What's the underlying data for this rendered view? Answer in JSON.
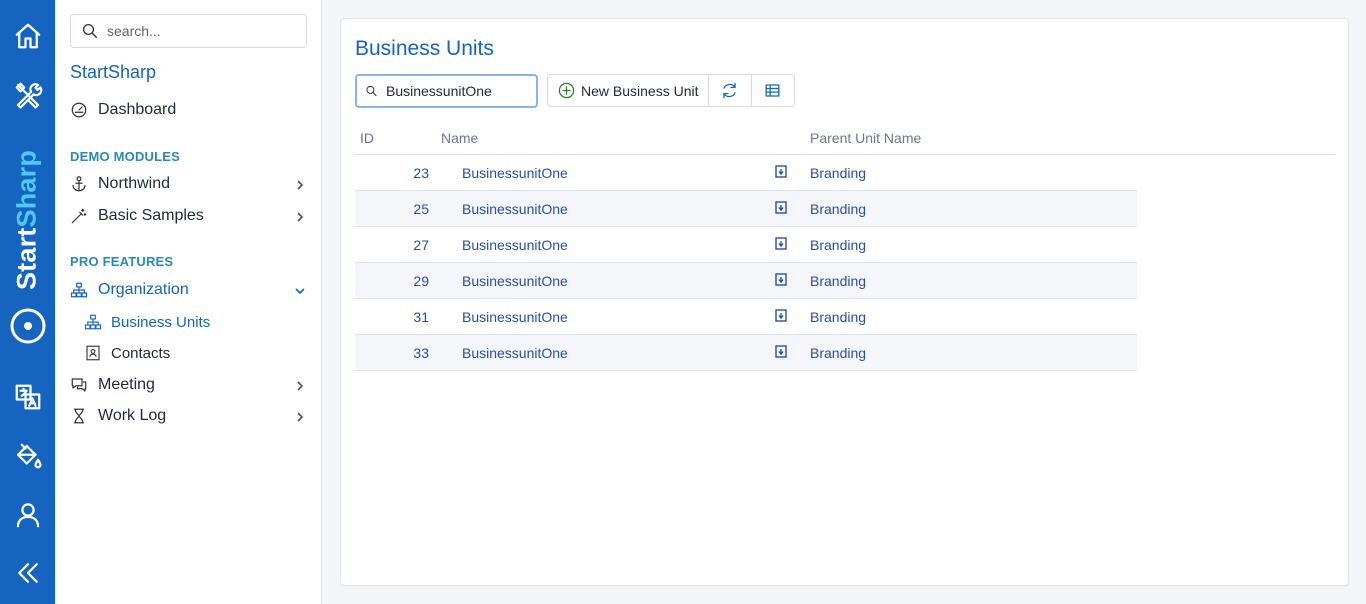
{
  "rail": {
    "brand_start": "Start",
    "brand_sharp": "Sharp"
  },
  "sidebar": {
    "search_placeholder": "search...",
    "app_title": "StartSharp",
    "dashboard": "Dashboard",
    "demo_modules_header": "DEMO MODULES",
    "northwind": "Northwind",
    "basic_samples": "Basic Samples",
    "pro_features_header": "PRO FEATURES",
    "organization": "Organization",
    "business_units": "Business Units",
    "contacts": "Contacts",
    "meeting": "Meeting",
    "work_log": "Work Log"
  },
  "main": {
    "title": "Business Units",
    "quick_search_value": "BusinessunitOne",
    "new_button": "New Business Unit",
    "columns": {
      "id": "ID",
      "name": "Name",
      "parent": "Parent Unit Name"
    },
    "rows": [
      {
        "id": "23",
        "name": "BusinessunitOne",
        "parent": "Branding"
      },
      {
        "id": "25",
        "name": "BusinessunitOne",
        "parent": "Branding"
      },
      {
        "id": "27",
        "name": "BusinessunitOne",
        "parent": "Branding"
      },
      {
        "id": "29",
        "name": "BusinessunitOne",
        "parent": "Branding"
      },
      {
        "id": "31",
        "name": "BusinessunitOne",
        "parent": "Branding"
      },
      {
        "id": "33",
        "name": "BusinessunitOne",
        "parent": "Branding"
      }
    ]
  },
  "colors": {
    "rail": "#1565c0",
    "accent": "#1565c0",
    "section_header": "#2a8ab8",
    "link": "#2a4fa8",
    "add_icon": "#2e7d32"
  },
  "icons": {
    "rail": [
      "home-icon",
      "tools-icon",
      "translate-icon",
      "paint-bucket-icon",
      "user-icon",
      "collapse-icon"
    ],
    "toolbar": [
      "plus-circle-icon",
      "refresh-icon",
      "column-picker-icon"
    ]
  }
}
